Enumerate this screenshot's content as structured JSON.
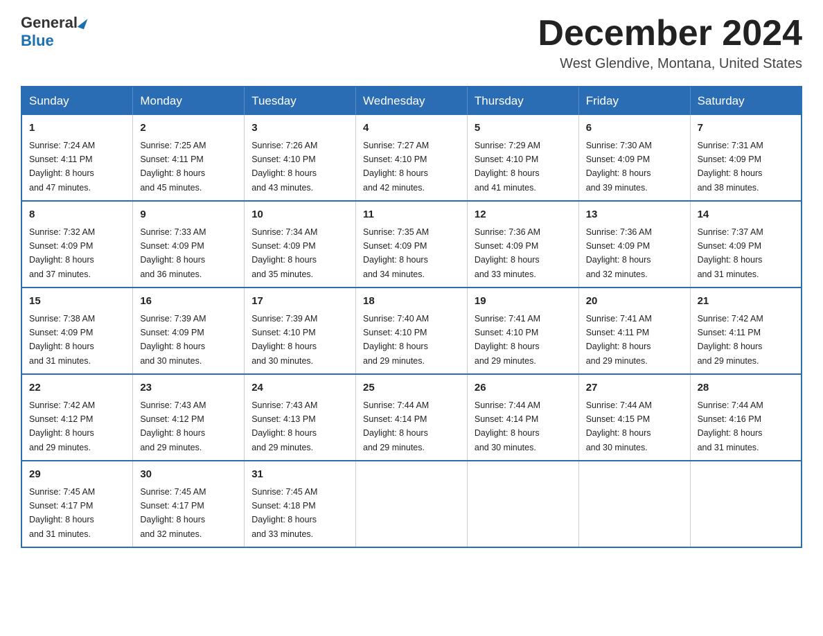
{
  "logo": {
    "general_text": "General",
    "blue_text": "Blue"
  },
  "title": {
    "month_year": "December 2024",
    "location": "West Glendive, Montana, United States"
  },
  "days_of_week": [
    "Sunday",
    "Monday",
    "Tuesday",
    "Wednesday",
    "Thursday",
    "Friday",
    "Saturday"
  ],
  "weeks": [
    [
      {
        "day": "1",
        "sunrise": "7:24 AM",
        "sunset": "4:11 PM",
        "daylight": "8 hours and 47 minutes."
      },
      {
        "day": "2",
        "sunrise": "7:25 AM",
        "sunset": "4:11 PM",
        "daylight": "8 hours and 45 minutes."
      },
      {
        "day": "3",
        "sunrise": "7:26 AM",
        "sunset": "4:10 PM",
        "daylight": "8 hours and 43 minutes."
      },
      {
        "day": "4",
        "sunrise": "7:27 AM",
        "sunset": "4:10 PM",
        "daylight": "8 hours and 42 minutes."
      },
      {
        "day": "5",
        "sunrise": "7:29 AM",
        "sunset": "4:10 PM",
        "daylight": "8 hours and 41 minutes."
      },
      {
        "day": "6",
        "sunrise": "7:30 AM",
        "sunset": "4:09 PM",
        "daylight": "8 hours and 39 minutes."
      },
      {
        "day": "7",
        "sunrise": "7:31 AM",
        "sunset": "4:09 PM",
        "daylight": "8 hours and 38 minutes."
      }
    ],
    [
      {
        "day": "8",
        "sunrise": "7:32 AM",
        "sunset": "4:09 PM",
        "daylight": "8 hours and 37 minutes."
      },
      {
        "day": "9",
        "sunrise": "7:33 AM",
        "sunset": "4:09 PM",
        "daylight": "8 hours and 36 minutes."
      },
      {
        "day": "10",
        "sunrise": "7:34 AM",
        "sunset": "4:09 PM",
        "daylight": "8 hours and 35 minutes."
      },
      {
        "day": "11",
        "sunrise": "7:35 AM",
        "sunset": "4:09 PM",
        "daylight": "8 hours and 34 minutes."
      },
      {
        "day": "12",
        "sunrise": "7:36 AM",
        "sunset": "4:09 PM",
        "daylight": "8 hours and 33 minutes."
      },
      {
        "day": "13",
        "sunrise": "7:36 AM",
        "sunset": "4:09 PM",
        "daylight": "8 hours and 32 minutes."
      },
      {
        "day": "14",
        "sunrise": "7:37 AM",
        "sunset": "4:09 PM",
        "daylight": "8 hours and 31 minutes."
      }
    ],
    [
      {
        "day": "15",
        "sunrise": "7:38 AM",
        "sunset": "4:09 PM",
        "daylight": "8 hours and 31 minutes."
      },
      {
        "day": "16",
        "sunrise": "7:39 AM",
        "sunset": "4:09 PM",
        "daylight": "8 hours and 30 minutes."
      },
      {
        "day": "17",
        "sunrise": "7:39 AM",
        "sunset": "4:10 PM",
        "daylight": "8 hours and 30 minutes."
      },
      {
        "day": "18",
        "sunrise": "7:40 AM",
        "sunset": "4:10 PM",
        "daylight": "8 hours and 29 minutes."
      },
      {
        "day": "19",
        "sunrise": "7:41 AM",
        "sunset": "4:10 PM",
        "daylight": "8 hours and 29 minutes."
      },
      {
        "day": "20",
        "sunrise": "7:41 AM",
        "sunset": "4:11 PM",
        "daylight": "8 hours and 29 minutes."
      },
      {
        "day": "21",
        "sunrise": "7:42 AM",
        "sunset": "4:11 PM",
        "daylight": "8 hours and 29 minutes."
      }
    ],
    [
      {
        "day": "22",
        "sunrise": "7:42 AM",
        "sunset": "4:12 PM",
        "daylight": "8 hours and 29 minutes."
      },
      {
        "day": "23",
        "sunrise": "7:43 AM",
        "sunset": "4:12 PM",
        "daylight": "8 hours and 29 minutes."
      },
      {
        "day": "24",
        "sunrise": "7:43 AM",
        "sunset": "4:13 PM",
        "daylight": "8 hours and 29 minutes."
      },
      {
        "day": "25",
        "sunrise": "7:44 AM",
        "sunset": "4:14 PM",
        "daylight": "8 hours and 29 minutes."
      },
      {
        "day": "26",
        "sunrise": "7:44 AM",
        "sunset": "4:14 PM",
        "daylight": "8 hours and 30 minutes."
      },
      {
        "day": "27",
        "sunrise": "7:44 AM",
        "sunset": "4:15 PM",
        "daylight": "8 hours and 30 minutes."
      },
      {
        "day": "28",
        "sunrise": "7:44 AM",
        "sunset": "4:16 PM",
        "daylight": "8 hours and 31 minutes."
      }
    ],
    [
      {
        "day": "29",
        "sunrise": "7:45 AM",
        "sunset": "4:17 PM",
        "daylight": "8 hours and 31 minutes."
      },
      {
        "day": "30",
        "sunrise": "7:45 AM",
        "sunset": "4:17 PM",
        "daylight": "8 hours and 32 minutes."
      },
      {
        "day": "31",
        "sunrise": "7:45 AM",
        "sunset": "4:18 PM",
        "daylight": "8 hours and 33 minutes."
      },
      null,
      null,
      null,
      null
    ]
  ],
  "labels": {
    "sunrise": "Sunrise:",
    "sunset": "Sunset:",
    "daylight": "Daylight:"
  }
}
